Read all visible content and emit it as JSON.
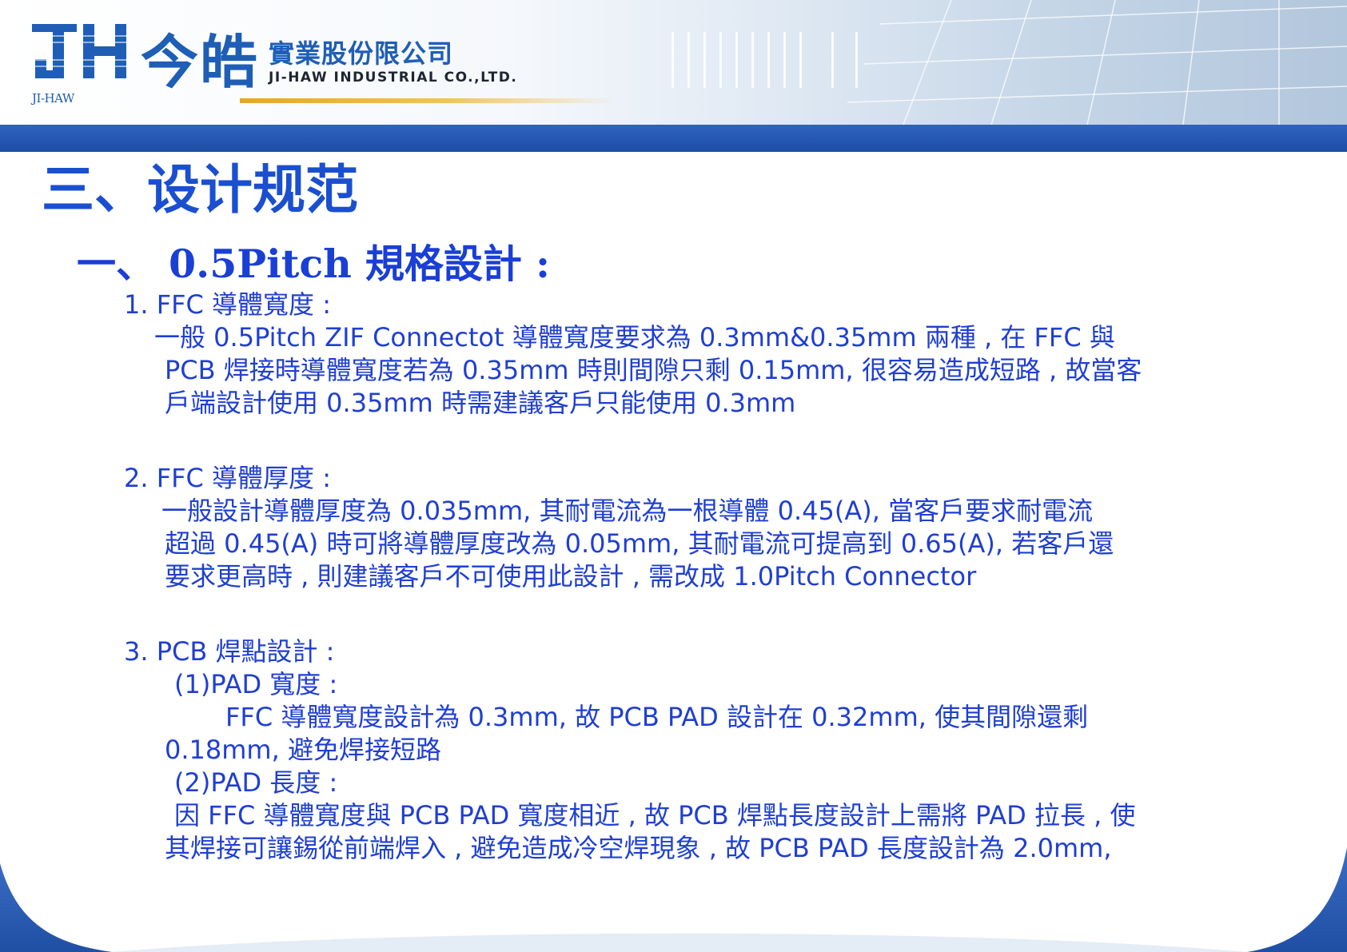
{
  "header": {
    "logo_text": "JI-HAW",
    "company_cn_short": "今皓",
    "company_cn_full": "實業股份限公司",
    "company_en": "JI-HAW INDUSTRIAL CO.,LTD."
  },
  "slide": {
    "title": "三、设计规范",
    "section_title": "一、 0.5Pitch 規格設計 :",
    "lines": [
      "1.  FFC 導體寬度 :",
      "一般 0.5Pitch ZIF Connectot 導體寬度要求為 0.3mm&0.35mm 兩種 , 在 FFC 與",
      "PCB 焊接時導體寬度若為 0.35mm 時則間隙只剩 0.15mm, 很容易造成短路 , 故當客",
      "戶端設計使用 0.35mm 時需建議客戶只能使用 0.3mm",
      "2. FFC 導體厚度 :",
      "一般設計導體厚度為 0.035mm, 其耐電流為一根導體 0.45(A),  當客戶要求耐電流",
      "超過 0.45(A) 時可將導體厚度改為 0.05mm, 其耐電流可提高到 0.65(A), 若客戶還",
      "要求更高時 , 則建議客戶不可使用此設計 , 需改成 1.0Pitch Connector",
      "3. PCB 焊點設計 :",
      "(1)PAD 寬度 :",
      "FFC 導體寬度設計為 0.3mm, 故 PCB PAD 設計在 0.32mm, 使其間隙還剩",
      "0.18mm, 避免焊接短路",
      "(2)PAD 長度 :",
      "因 FFC 導體寬度與 PCB PAD 寬度相近 , 故 PCB 焊點長度設計上需將 PAD 拉長 , 使",
      "其焊接可讓錫從前端焊入 , 避免造成冷空焊現象 , 故 PCB PAD 長度設計為 2.0mm,"
    ]
  },
  "colors": {
    "brand_blue": "#1e5eb6",
    "text_blue": "#1f3fd2",
    "title_blue": "#1a4fd0",
    "bar_blue": "#2457b2",
    "accent_orange": "#e8a528"
  }
}
